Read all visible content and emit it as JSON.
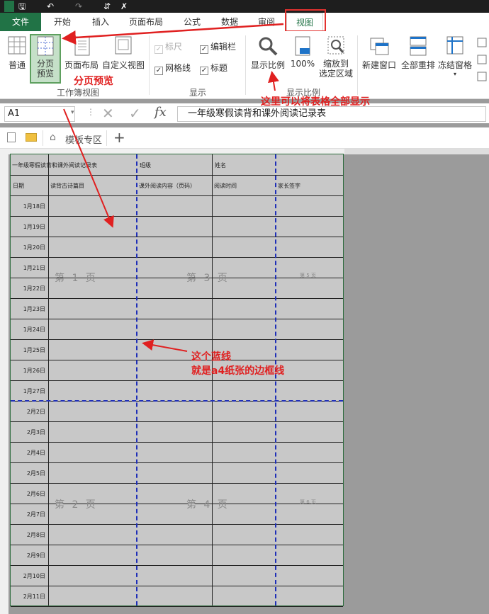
{
  "tabs": [
    "文件",
    "开始",
    "插入",
    "页面布局",
    "公式",
    "数据",
    "审阅",
    "视图"
  ],
  "ribbon": {
    "views": [
      "普通",
      "分页\n预览",
      "页面布局",
      "自定义视图"
    ],
    "views_group": "工作簿视图",
    "show": [
      {
        "label": "标尺",
        "checked": true,
        "disabled": true
      },
      {
        "label": "编辑栏",
        "checked": true,
        "disabled": false
      },
      {
        "label": "网格线",
        "checked": true,
        "disabled": false
      },
      {
        "label": "标题",
        "checked": true,
        "disabled": false
      }
    ],
    "show_group": "显示",
    "zoom": [
      "显示比例",
      "100%",
      "缩放到\n选定区域"
    ],
    "zoom_group": "显示比例",
    "window": [
      "新建窗口",
      "全部重排",
      "冻结窗格"
    ]
  },
  "formula_bar": {
    "name_box": "A1",
    "content": "一年级寒假读背和课外阅读记录表"
  },
  "sheet_tab": "模板专区",
  "table": {
    "header_row": [
      "一年级寒假读背和课外阅读记录表",
      "",
      "",
      "班级",
      "姓名",
      ""
    ],
    "col_headers": [
      "日期",
      "读背古诗篇目",
      "课外阅读内容（页码）",
      "阅读时间",
      "家长签字"
    ],
    "dates": [
      "1月18日",
      "1月19日",
      "1月20日",
      "1月21日",
      "1月22日",
      "1月23日",
      "1月24日",
      "1月25日",
      "1月26日",
      "1月27日",
      "2月2日",
      "2月3日",
      "2月4日",
      "2月5日",
      "2月6日",
      "2月7日",
      "2月8日",
      "2月9日",
      "2月10日",
      "2月11日"
    ]
  },
  "watermarks": [
    "第 1 页",
    "第 3 页",
    "第 5 页",
    "第 2 页",
    "第 4 页",
    "第 6 页"
  ],
  "annotations": {
    "page_break_preview": "分页预览",
    "zoom_hint": "这里可以将表格全部显示",
    "blue_line": "这个蓝线\n就是a4纸张的边框线"
  }
}
